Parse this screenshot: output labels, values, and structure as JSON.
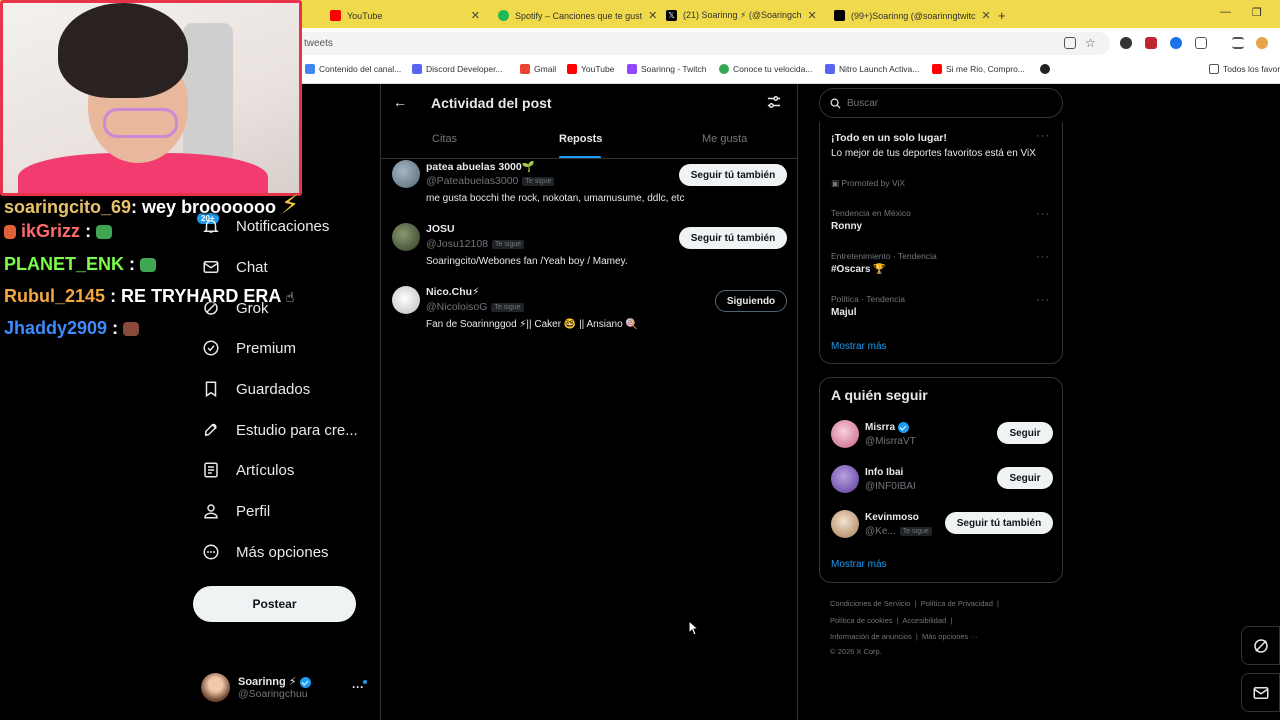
{
  "browser": {
    "tabs": [
      {
        "label": "YouTube",
        "color": "#ff0000"
      },
      {
        "label": "Spotify – Canciones que te gust",
        "color": "#1db954"
      },
      {
        "label": "(21) Soarinng ⚡ (@Soaringch",
        "color": "#000000"
      },
      {
        "label": "(99+)Soarinng (@soarinngtwitc",
        "color": "#000000"
      }
    ],
    "new_tab": "+",
    "url": "tweets",
    "bookmarks": [
      {
        "label": "Contenido del canal...",
        "color": "#4285f4"
      },
      {
        "label": "Discord Developer...",
        "color": "#5865f2"
      },
      {
        "label": "Gmail",
        "color": "#ea4335"
      },
      {
        "label": "YouTube",
        "color": "#ff0000"
      },
      {
        "label": "Soarinng - Twitch",
        "color": "#9146ff"
      },
      {
        "label": "Conoce tu velocida...",
        "color": "#34a853"
      },
      {
        "label": "Nitro Launch Activa...",
        "color": "#5865f2"
      },
      {
        "label": "Si me Rio, Compro...",
        "color": "#ff0000"
      }
    ],
    "all_bookmarks": "Todos los favor"
  },
  "stream_chat": [
    {
      "user": "soaringcito_69",
      "msg": ": wey brooooooo",
      "color": "#e8c26a"
    },
    {
      "user": "ikGrizz",
      "msg": ":",
      "color": "#ff6b6b"
    },
    {
      "user": "PLANET_ENK",
      "msg": ":",
      "color": "#7cfc4a"
    },
    {
      "user": "Rubul_2145",
      "msg": ": RE TRYHARD ERA",
      "color": "#f5a742"
    },
    {
      "user": "Jhaddy2909",
      "msg": ":",
      "color": "#3d8bff"
    }
  ],
  "nav": {
    "badge": "20+",
    "items": [
      "Notificaciones",
      "Chat",
      "Grok",
      "Premium",
      "Guardados",
      "Estudio para cre...",
      "Artículos",
      "Perfil",
      "Más opciones"
    ],
    "post_button": "Postear",
    "account": {
      "name": "Soarinng ⚡",
      "handle": "@Soaringchuu"
    },
    "more": "···"
  },
  "post_activity": {
    "title": "Actividad del post",
    "tabs": [
      "Citas",
      "Reposts",
      "Me gusta"
    ],
    "active_tab": "Reposts",
    "users": [
      {
        "name": "patea abuelas 3000🌱",
        "handle": "@Pateabuelas3000",
        "follows_you": "Te sigue",
        "bio": "me gusta bocchi the rock, nokotan, umamusume, ddlc, etc",
        "button": "Seguir tú también",
        "avatar_color": "#6b7f8f"
      },
      {
        "name": "JOSU",
        "handle": "@Josu12108",
        "follows_you": "Te sigue",
        "bio": "Soaringcito/Webones fan /Yeah boy / Mamey.",
        "button": "Seguir tú también",
        "avatar_color": "#4a5a3a"
      },
      {
        "name": "Nico.Chu⚡",
        "handle": "@NicoloisoG",
        "follows_you": "Te sigue",
        "bio": "Fan de Soarinnggod ⚡|| Caker 🤓 || Ansiano 🍭",
        "button": "Siguiendo",
        "avatar_color": "#d8d8d8"
      }
    ]
  },
  "right": {
    "search_placeholder": "Buscar",
    "trends": {
      "promo": {
        "title": "¡Todo en un solo lugar!",
        "text": "Lo mejor de tus deportes favoritos  está en ViX",
        "promoted": "Promoted by ViX"
      },
      "items": [
        {
          "meta": "Tendencia en México",
          "title": "Ronny"
        },
        {
          "meta": "Entretenimiento · Tendencia",
          "title": "#Oscars 🏆"
        },
        {
          "meta": "Política · Tendencia",
          "title": "Majul"
        }
      ],
      "more": "Mostrar más"
    },
    "who_to_follow": {
      "title": "A quién seguir",
      "users": [
        {
          "name": "Misrra",
          "handle": "@MisrraVT",
          "button": "Seguir",
          "verified": true,
          "avatar_color": "#e8a0b8"
        },
        {
          "name": "Info Ibai",
          "handle": "@INF0IBAI",
          "button": "Seguir",
          "verified": false,
          "avatar_color": "#7d5ab8"
        },
        {
          "name": "Kevinmoso",
          "handle": "@Ke...",
          "follows_you": "Te sigue",
          "button": "Seguir tú también",
          "verified": false,
          "avatar_color": "#c9a27a"
        }
      ],
      "more": "Mostrar más"
    },
    "footer": [
      [
        "Condiciones de Servicio",
        "Política de Privacidad"
      ],
      [
        "Política de cookies",
        "Accesibilidad"
      ],
      [
        "Información de anuncios",
        "Más opciones ···"
      ],
      [
        "© 2026 X Corp."
      ]
    ]
  },
  "colors": {
    "accent": "#1d9bf0",
    "bg": "#000000",
    "border": "#2f3336",
    "muted": "#71767b"
  }
}
